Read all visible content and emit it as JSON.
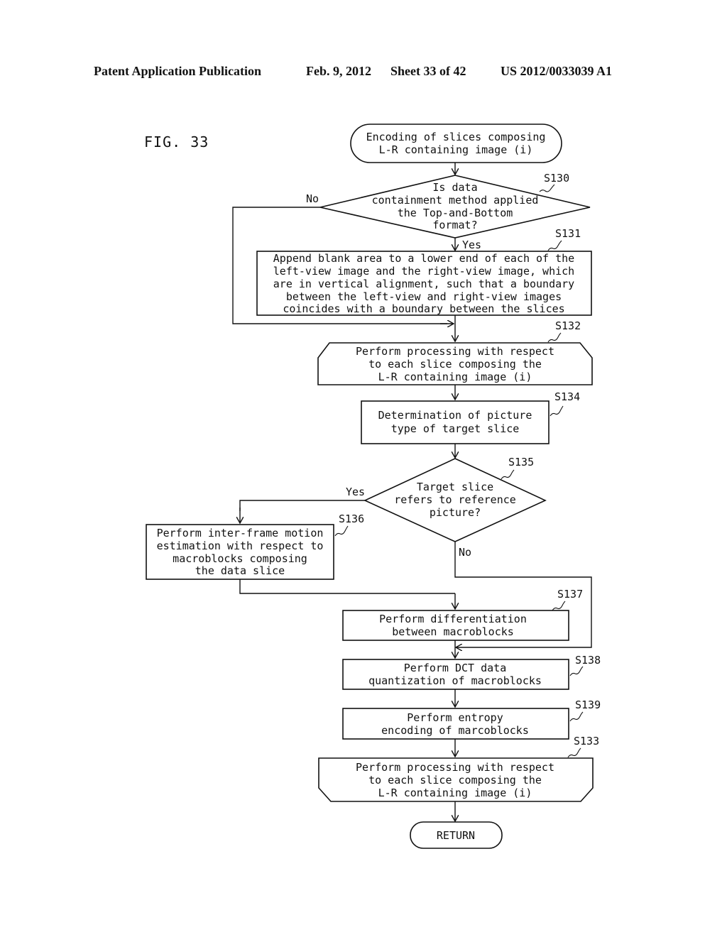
{
  "header": {
    "publication": "Patent Application Publication",
    "date": "Feb. 9, 2012",
    "sheet": "Sheet 33 of 42",
    "patent_number": "US 2012/0033039 A1"
  },
  "figure": {
    "label": "FIG. 33"
  },
  "flowchart": {
    "start": {
      "lines": [
        "Encoding of slices composing",
        "L-R containing image (i)"
      ]
    },
    "s130": {
      "step": "S130",
      "lines": [
        "Is data",
        "containment method applied",
        "the Top-and-Bottom",
        "format?"
      ],
      "yes_label": "Yes",
      "no_label": "No"
    },
    "s131": {
      "step": "S131",
      "lines": [
        "Append blank area to a lower end of each of the",
        "left-view image and the right-view image, which",
        "are in vertical alignment, such that a boundary",
        "between the left-view and right-view images",
        "coincides with a boundary between the slices"
      ]
    },
    "s132": {
      "step": "S132",
      "lines": [
        "Perform processing with respect",
        "to each slice composing the",
        "L-R containing image (i)"
      ]
    },
    "s134": {
      "step": "S134",
      "lines": [
        "Determination of picture",
        "type of target slice"
      ]
    },
    "s135": {
      "step": "S135",
      "lines": [
        "Target slice",
        "refers to reference",
        "picture?"
      ],
      "yes_label": "Yes",
      "no_label": "No"
    },
    "s136": {
      "step": "S136",
      "lines": [
        "Perform inter-frame motion",
        "estimation with respect to",
        "macroblocks composing",
        "the data slice"
      ]
    },
    "s137": {
      "step": "S137",
      "lines": [
        "Perform differentiation",
        "between macroblocks"
      ]
    },
    "s138": {
      "step": "S138",
      "lines": [
        "Perform DCT data",
        "quantization of macroblocks"
      ]
    },
    "s139": {
      "step": "S139",
      "lines": [
        "Perform entropy",
        "encoding of marcoblocks"
      ]
    },
    "s133": {
      "step": "S133",
      "lines": [
        "Perform processing with respect",
        "to each slice composing the",
        "L-R containing image (i)"
      ]
    },
    "end": {
      "label": "RETURN"
    }
  }
}
